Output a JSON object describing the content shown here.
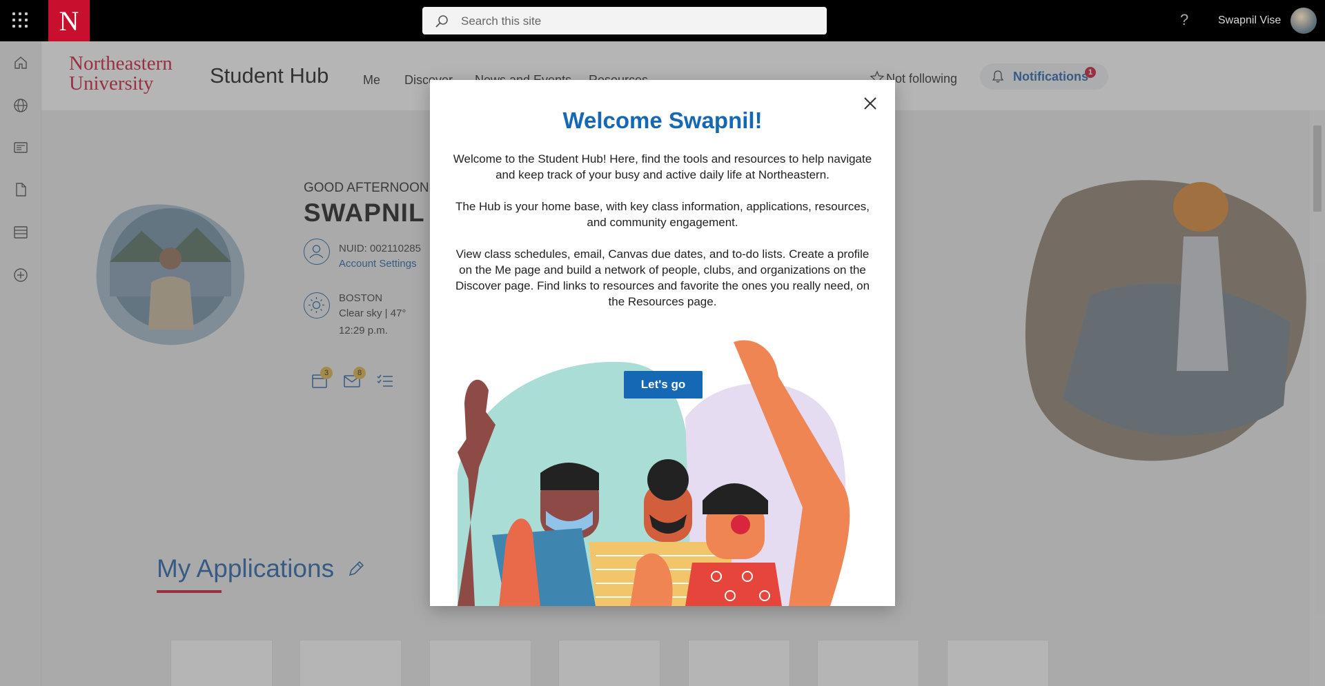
{
  "topbar": {
    "logo_letter": "N",
    "search_placeholder": "Search this site",
    "help": "?",
    "user_name": "Swapnil Vise"
  },
  "header": {
    "university_line1": "Northeastern",
    "university_line2": "University",
    "title": "Student Hub",
    "nav": [
      "Me",
      "Discover",
      "News and Events",
      "Resources"
    ],
    "follow_label": "Not following",
    "notifications_label": "Notifications",
    "notifications_count": "1"
  },
  "profile": {
    "greeting": "GOOD AFTERNOON,",
    "name": "SWAPNIL",
    "nuid": "NUID: 002110285",
    "account_settings": "Account Settings",
    "city": "BOSTON",
    "weather": "Clear sky | 47°",
    "time": "12:29 p.m."
  },
  "quick_icons": {
    "calendar_count": "3",
    "mail_count": "8"
  },
  "apps": {
    "title": "My Applications"
  },
  "modal": {
    "title": "Welcome Swapnil!",
    "para1": "Welcome to the Student Hub! Here, find the tools and resources to help navigate and keep track of your busy and active daily life at Northeastern.",
    "para2": "The Hub is your home base, with key class information, applications, resources, and community engagement.",
    "para3": "View class schedules, email, Canvas due dates, and to-do lists. Create a profile on the Me page and build a network of people, clubs, and organizations on the Discover page. Find links to resources and favorite the ones you really need, on the Resources page.",
    "button": "Let's go"
  },
  "colors": {
    "brand_red": "#c8102e",
    "accent_blue": "#1468b4",
    "badge_gold": "#e3b13c"
  }
}
